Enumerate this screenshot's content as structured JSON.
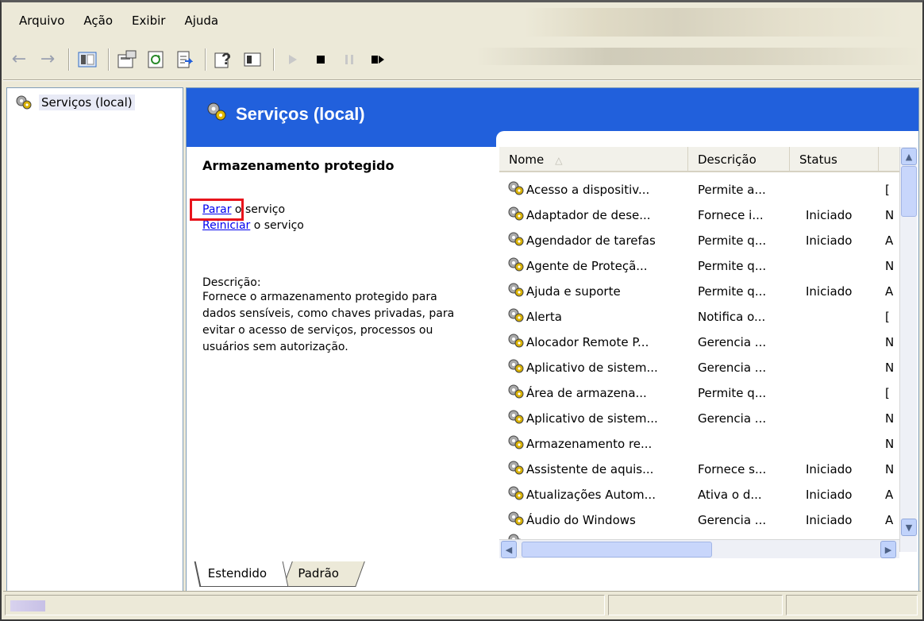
{
  "menu": [
    "Arquivo",
    "Ação",
    "Exibir",
    "Ajuda"
  ],
  "toolbar_icons": [
    "back-arrow-icon",
    "forward-arrow-icon",
    "show-hide-tree-icon",
    "properties-icon",
    "refresh-icon",
    "export-list-icon",
    "help-icon",
    "console-icon",
    "play-icon",
    "stop-icon",
    "pause-icon",
    "restart-icon"
  ],
  "tree": {
    "root_label": "Serviços (local)"
  },
  "header": {
    "title": "Serviços (local)",
    "accent": "#2160dc"
  },
  "details": {
    "service_name": "Armazenamento protegido",
    "stop_link": "Parar",
    "stop_suffix": " o serviço",
    "restart_link": "Reiniciar",
    "restart_suffix": " o serviço",
    "description_label": "Descrição:",
    "description_text": "Fornece o armazenamento protegido para dados sensíveis, como chaves privadas, para evitar o acesso de serviços, processos ou usuários sem autorização."
  },
  "list": {
    "columns": [
      "Nome",
      "Descrição",
      "Status"
    ],
    "rows": [
      {
        "name": "Acesso a dispositiv...",
        "desc": "Permite a...",
        "status": "",
        "extra": "[ "
      },
      {
        "name": "Adaptador de dese...",
        "desc": "Fornece i...",
        "status": "Iniciado",
        "extra": "N"
      },
      {
        "name": "Agendador de tarefas",
        "desc": "Permite q...",
        "status": "Iniciado",
        "extra": "A"
      },
      {
        "name": "Agente de Proteçã...",
        "desc": "Permite q...",
        "status": "",
        "extra": "N"
      },
      {
        "name": "Ajuda e suporte",
        "desc": "Permite q...",
        "status": "Iniciado",
        "extra": "A"
      },
      {
        "name": "Alerta",
        "desc": "Notifica o...",
        "status": "",
        "extra": "["
      },
      {
        "name": "Alocador Remote P...",
        "desc": "Gerencia ...",
        "status": "",
        "extra": "N"
      },
      {
        "name": "Aplicativo de sistem...",
        "desc": "Gerencia ...",
        "status": "",
        "extra": "N"
      },
      {
        "name": "Área de armazena...",
        "desc": "Permite q...",
        "status": "",
        "extra": "["
      },
      {
        "name": "Aplicativo de sistem...",
        "desc": "Gerencia ...",
        "status": "",
        "extra": "N"
      },
      {
        "name": "Armazenamento re...",
        "desc": "",
        "status": "",
        "extra": "N"
      },
      {
        "name": "Assistente de aquis...",
        "desc": "Fornece s...",
        "status": "Iniciado",
        "extra": "N"
      },
      {
        "name": "Atualizações Autom...",
        "desc": "Ativa o d...",
        "status": "Iniciado",
        "extra": "A"
      },
      {
        "name": "Áudio do Windows",
        "desc": "Gerencia ...",
        "status": "Iniciado",
        "extra": "A"
      }
    ]
  },
  "tabs": [
    "Estendido",
    "Padrão"
  ],
  "colors": {
    "highlight": "#e8141c",
    "link": "#0000ee"
  }
}
